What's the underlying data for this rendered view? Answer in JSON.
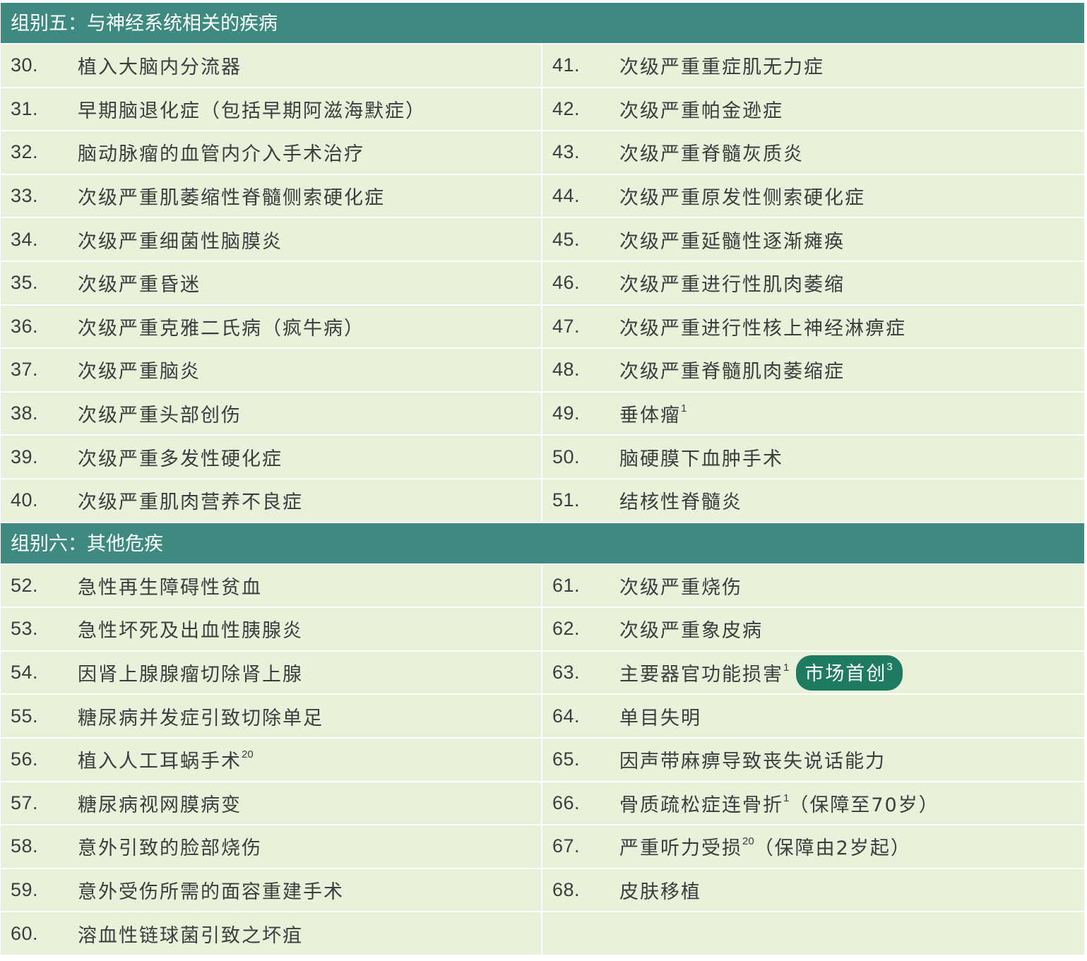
{
  "group5": {
    "header": "组别五：与神经系统相关的疾病",
    "rows": [
      {
        "l_num": "30.",
        "l_text": "植入大脑内分流器",
        "l_sup": "",
        "r_num": "41.",
        "r_text": "次级严重重症肌无力症",
        "r_sup": ""
      },
      {
        "l_num": "31.",
        "l_text": "早期脑退化症（包括早期阿滋海默症）",
        "l_sup": "",
        "r_num": "42.",
        "r_text": "次级严重帕金逊症",
        "r_sup": ""
      },
      {
        "l_num": "32.",
        "l_text": "脑动脉瘤的血管内介入手术治疗",
        "l_sup": "",
        "r_num": "43.",
        "r_text": "次级严重脊髓灰质炎",
        "r_sup": ""
      },
      {
        "l_num": "33.",
        "l_text": "次级严重肌萎缩性脊髓侧索硬化症",
        "l_sup": "",
        "r_num": "44.",
        "r_text": "次级严重原发性侧索硬化症",
        "r_sup": ""
      },
      {
        "l_num": "34.",
        "l_text": "次级严重细菌性脑膜炎",
        "l_sup": "",
        "r_num": "45.",
        "r_text": "次级严重延髓性逐渐瘫痪",
        "r_sup": ""
      },
      {
        "l_num": "35.",
        "l_text": "次级严重昏迷",
        "l_sup": "",
        "r_num": "46.",
        "r_text": "次级严重进行性肌肉萎缩",
        "r_sup": ""
      },
      {
        "l_num": "36.",
        "l_text": "次级严重克雅二氏病（疯牛病）",
        "l_sup": "",
        "r_num": "47.",
        "r_text": "次级严重进行性核上神经淋痹症",
        "r_sup": ""
      },
      {
        "l_num": "37.",
        "l_text": "次级严重脑炎",
        "l_sup": "",
        "r_num": "48.",
        "r_text": "次级严重脊髓肌肉萎缩症",
        "r_sup": ""
      },
      {
        "l_num": "38.",
        "l_text": "次级严重头部创伤",
        "l_sup": "",
        "r_num": "49.",
        "r_text": "垂体瘤",
        "r_sup": "1"
      },
      {
        "l_num": "39.",
        "l_text": "次级严重多发性硬化症",
        "l_sup": "",
        "r_num": "50.",
        "r_text": "脑硬膜下血肿手术",
        "r_sup": ""
      },
      {
        "l_num": "40.",
        "l_text": "次级严重肌肉营养不良症",
        "l_sup": "",
        "r_num": "51.",
        "r_text": "结核性脊髓炎",
        "r_sup": ""
      }
    ]
  },
  "group6": {
    "header": "组别六：其他危疾",
    "rows": [
      {
        "l_num": "52.",
        "l_text": "急性再生障碍性贫血",
        "l_sup": "",
        "r_num": "61.",
        "r_text": "次级严重烧伤",
        "r_sup": ""
      },
      {
        "l_num": "53.",
        "l_text": "急性坏死及出血性胰腺炎",
        "l_sup": "",
        "r_num": "62.",
        "r_text": "次级严重象皮病",
        "r_sup": ""
      },
      {
        "l_num": "54.",
        "l_text": "因肾上腺腺瘤切除肾上腺",
        "l_sup": "",
        "r_num": "63.",
        "r_text": "主要器官功能损害",
        "r_sup": "1",
        "badge": "市场首创",
        "badge_sup": "3"
      },
      {
        "l_num": "55.",
        "l_text": "糖尿病并发症引致切除单足",
        "l_sup": "",
        "r_num": "64.",
        "r_text": "单目失明",
        "r_sup": ""
      },
      {
        "l_num": "56.",
        "l_text": "植入人工耳蜗手术",
        "l_sup": "20",
        "r_num": "65.",
        "r_text": "因声带麻痹导致丧失说话能力",
        "r_sup": ""
      },
      {
        "l_num": "57.",
        "l_text": "糖尿病视网膜病变",
        "l_sup": "",
        "r_num": "66.",
        "r_text": "骨质疏松症连骨折",
        "r_sup": "1",
        "r_tail": "（保障至70岁）"
      },
      {
        "l_num": "58.",
        "l_text": "意外引致的脸部烧伤",
        "l_sup": "",
        "r_num": "67.",
        "r_text": "严重听力受损",
        "r_sup": "20",
        "r_tail": "（保障由2岁起）"
      },
      {
        "l_num": "59.",
        "l_text": "意外受伤所需的面容重建手术",
        "l_sup": "",
        "r_num": "68.",
        "r_text": "皮肤移植",
        "r_sup": ""
      },
      {
        "l_num": "60.",
        "l_text": "溶血性链球菌引致之坏疽",
        "l_sup": "",
        "r_num": "",
        "r_text": "",
        "r_sup": ""
      }
    ]
  },
  "colors": {
    "header_bg": "#3e8a80",
    "row_bg": "#e8f1da",
    "badge_bg": "#1f7a62",
    "text": "#3d3d3d"
  }
}
